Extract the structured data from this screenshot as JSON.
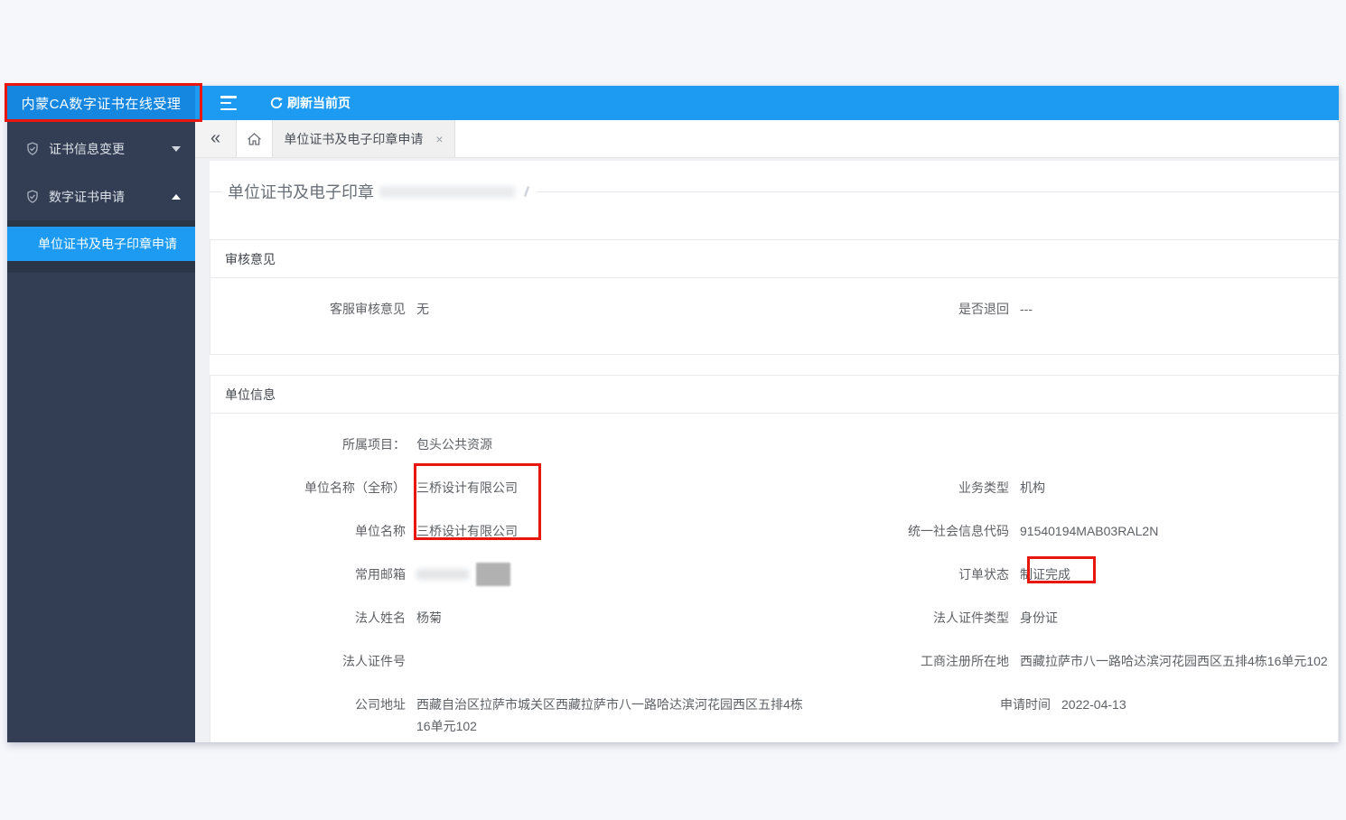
{
  "colors": {
    "topbar_blue": "#1d9bf2",
    "sidebar_dark": "#333e54",
    "sidebar_header_blue": "#1587e0",
    "active_item_blue": "#1d9bf2",
    "annotation_red": "#e8160c",
    "redaction_gray": "#b1b1b1"
  },
  "sidebar": {
    "title": "内蒙CA数字证书在线受理",
    "items": [
      {
        "label": "证书信息变更",
        "caret": "down"
      },
      {
        "label": "数字证书申请",
        "caret": "up"
      }
    ],
    "active_subitem": "单位证书及电子印章申请"
  },
  "topbar": {
    "refresh_label": "刷新当前页"
  },
  "tabbar": {
    "back_glyph": "«",
    "tab_label": "单位证书及电子印章申请",
    "close_glyph": "×"
  },
  "main": {
    "heading": "单位证书及电子印章",
    "review": {
      "title": "审核意见",
      "left": {
        "label": "客服审核意见",
        "value": "无"
      },
      "right": {
        "label": "是否退回",
        "value": "---"
      }
    },
    "unit": {
      "title": "单位信息",
      "rows": [
        {
          "left": {
            "label": "所属项目：",
            "value": "包头公共资源"
          },
          "right": {
            "label": "",
            "value": ""
          }
        },
        {
          "left": {
            "label": "单位名称（全称）",
            "value": "三桥设计有限公司"
          },
          "right": {
            "label": "业务类型",
            "value": "机构"
          }
        },
        {
          "left": {
            "label": "单位名称",
            "value": "三桥设计有限公司"
          },
          "right": {
            "label": "统一社会信息代码",
            "value": "91540194MAB03RAL2N"
          }
        },
        {
          "left": {
            "label": "常用邮箱",
            "value": ""
          },
          "right": {
            "label": "订单状态",
            "value": "制证完成"
          }
        },
        {
          "left": {
            "label": "法人姓名",
            "value": "杨菊"
          },
          "right": {
            "label": "法人证件类型",
            "value": "身份证"
          }
        },
        {
          "left": {
            "label": "法人证件号",
            "value": ""
          },
          "right": {
            "label": "工商注册所在地",
            "value": "西藏拉萨市八一路哈达滨河花园西区五排4栋16单元102"
          }
        },
        {
          "left": {
            "label": "公司地址",
            "value": "西藏自治区拉萨市城关区西藏拉萨市八一路哈达滨河花园西区五排4栋16单元102"
          },
          "right": {
            "label": "申请时间",
            "value": "2022-04-13"
          }
        }
      ]
    }
  }
}
